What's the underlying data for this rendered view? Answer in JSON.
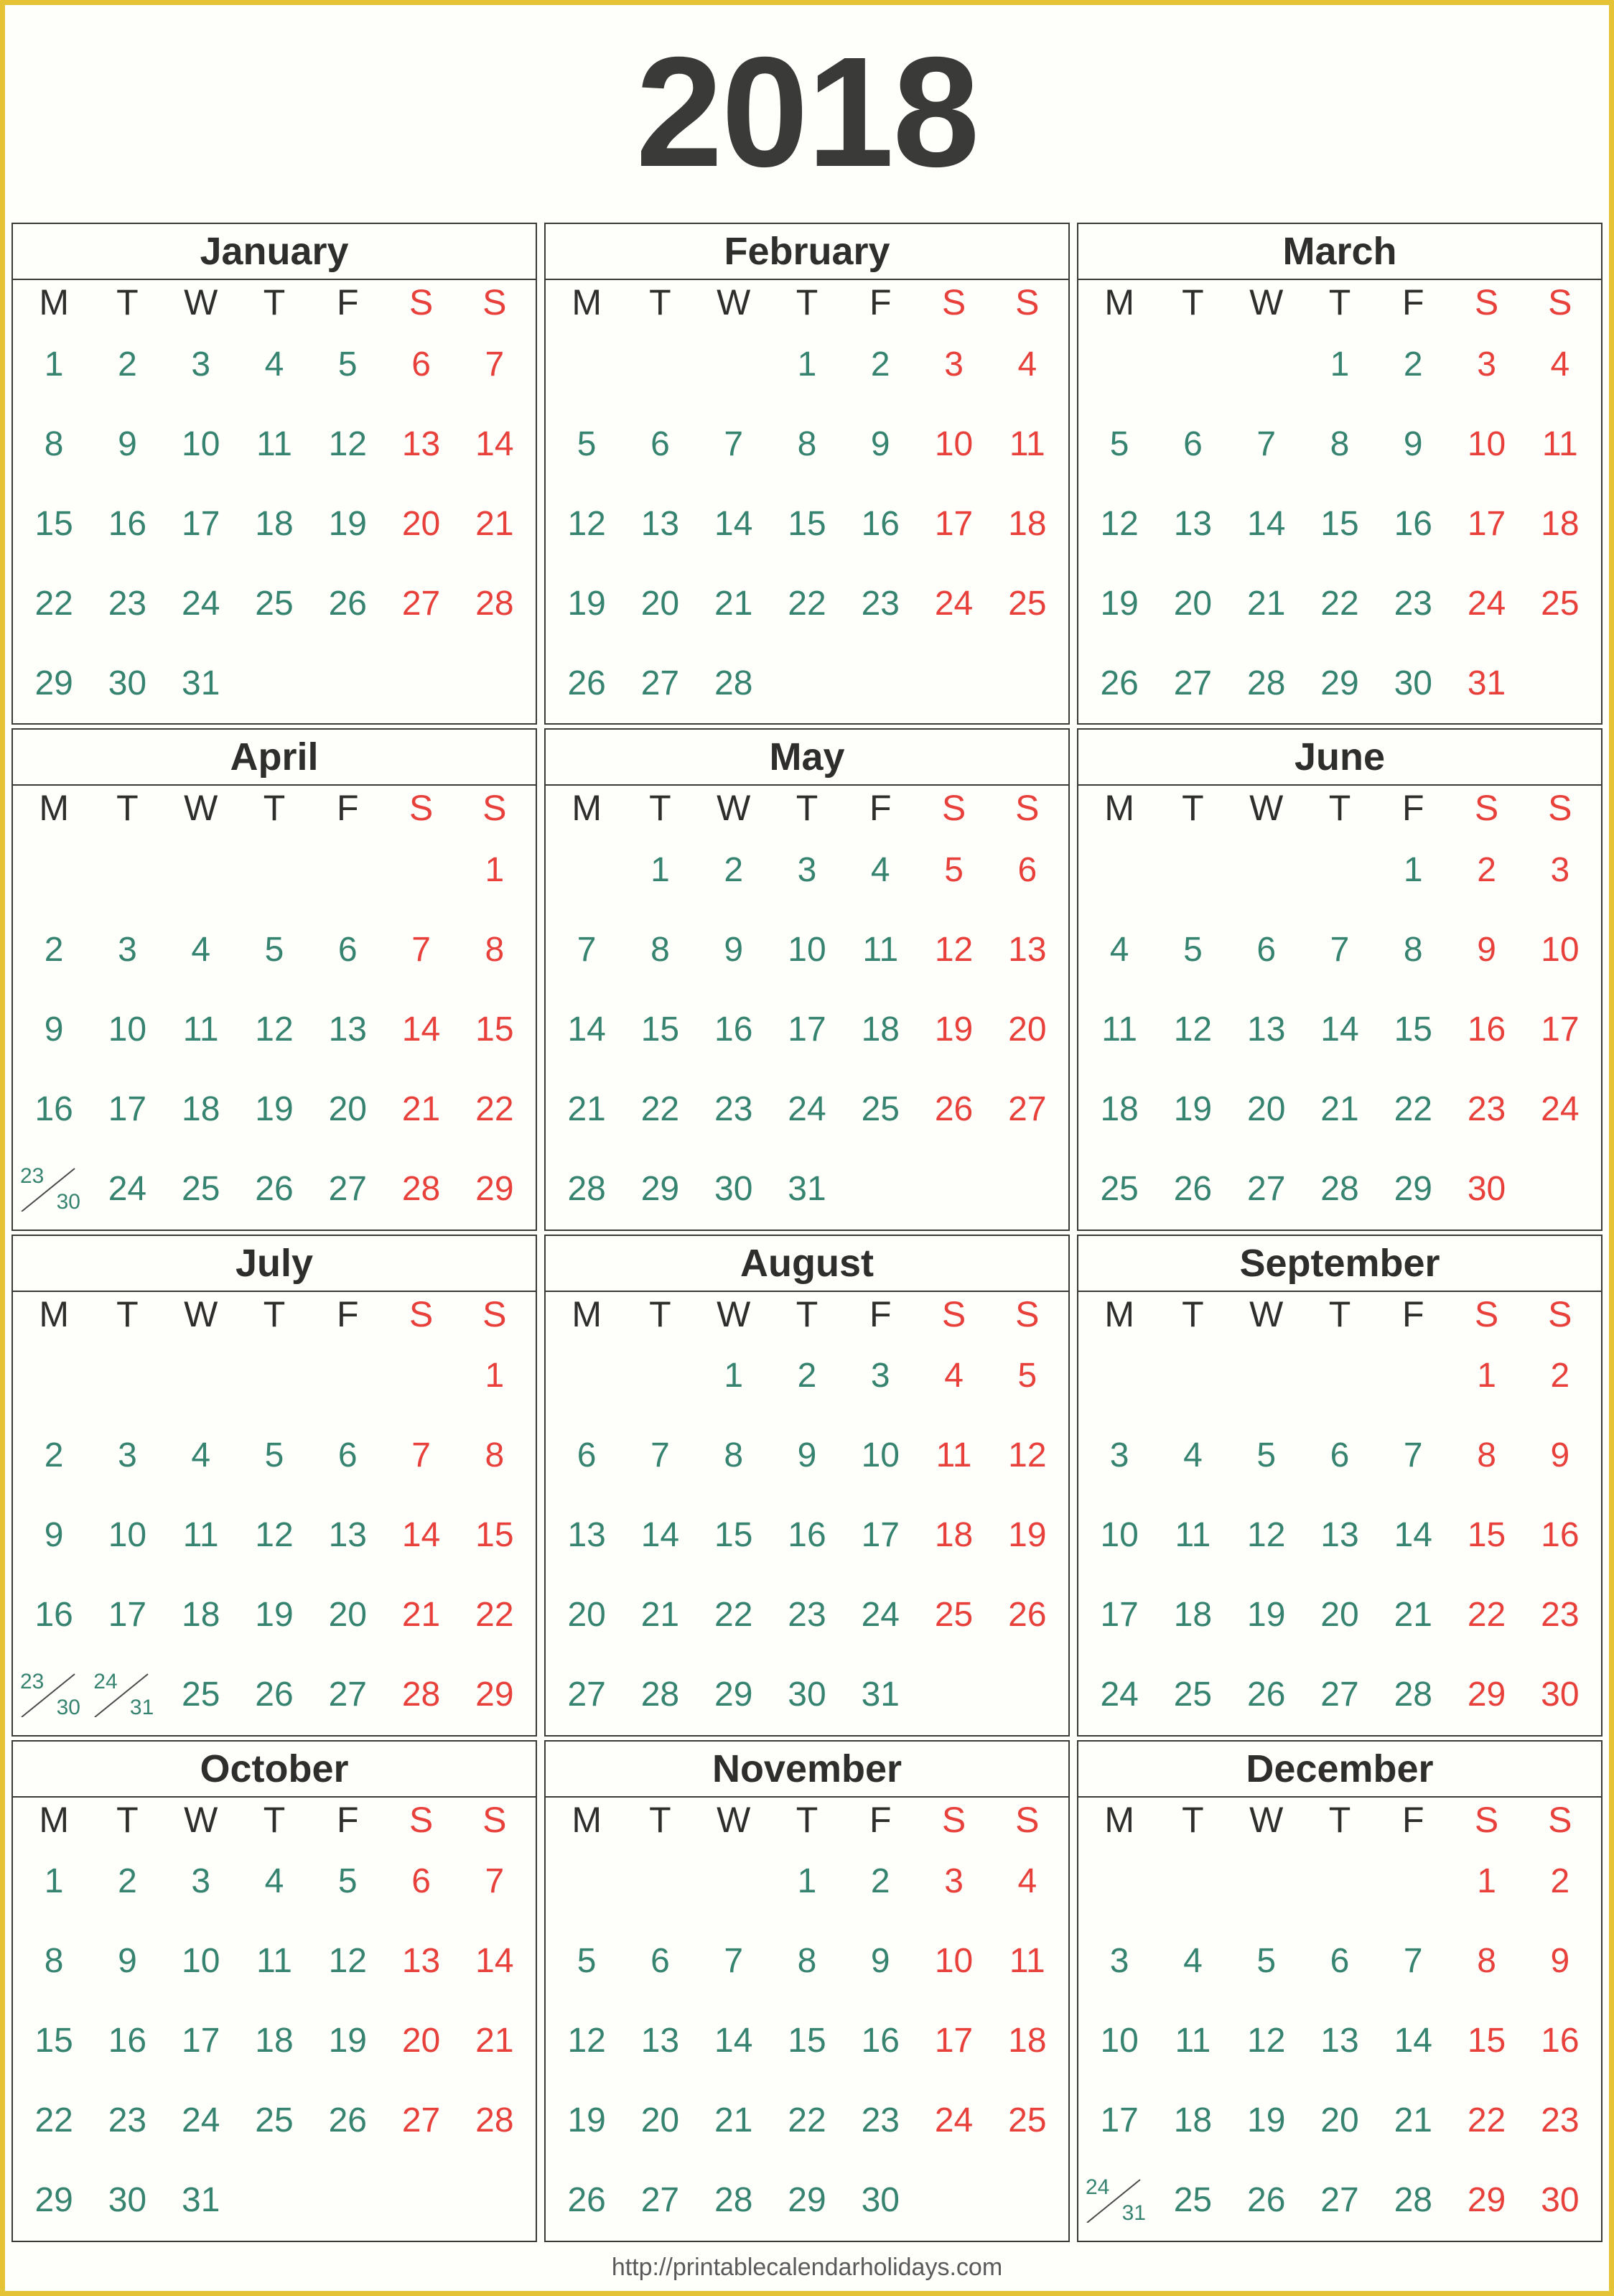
{
  "title": "2018",
  "footer": {
    "url": "http://printablecalendarholidays.com"
  },
  "colors": {
    "border": "#E5C337",
    "weekday": "#368470",
    "weekend": "#E8403A",
    "heading": "#2E2E2D",
    "grid_line": "#3A3A39",
    "page_bg": "#FEFEFB"
  },
  "weekday_headers": [
    {
      "label": "M",
      "weekend": false
    },
    {
      "label": "T",
      "weekend": false
    },
    {
      "label": "W",
      "weekend": false
    },
    {
      "label": "T",
      "weekend": false
    },
    {
      "label": "F",
      "weekend": false
    },
    {
      "label": "S",
      "weekend": true
    },
    {
      "label": "S",
      "weekend": true
    }
  ],
  "months": [
    {
      "name": "January",
      "weeks": [
        [
          "1",
          "2",
          "3",
          "4",
          "5",
          "6",
          "7"
        ],
        [
          "8",
          "9",
          "10",
          "11",
          "12",
          "13",
          "14"
        ],
        [
          "15",
          "16",
          "17",
          "18",
          "19",
          "20",
          "21"
        ],
        [
          "22",
          "23",
          "24",
          "25",
          "26",
          "27",
          "28"
        ],
        [
          "29",
          "30",
          "31",
          "",
          "",
          "",
          ""
        ]
      ]
    },
    {
      "name": "February",
      "weeks": [
        [
          "",
          "",
          "",
          "1",
          "2",
          "3",
          "4"
        ],
        [
          "5",
          "6",
          "7",
          "8",
          "9",
          "10",
          "11"
        ],
        [
          "12",
          "13",
          "14",
          "15",
          "16",
          "17",
          "18"
        ],
        [
          "19",
          "20",
          "21",
          "22",
          "23",
          "24",
          "25"
        ],
        [
          "26",
          "27",
          "28",
          "",
          "",
          "",
          ""
        ]
      ]
    },
    {
      "name": "March",
      "weeks": [
        [
          "",
          "",
          "",
          "1",
          "2",
          "3",
          "4"
        ],
        [
          "5",
          "6",
          "7",
          "8",
          "9",
          "10",
          "11"
        ],
        [
          "12",
          "13",
          "14",
          "15",
          "16",
          "17",
          "18"
        ],
        [
          "19",
          "20",
          "21",
          "22",
          "23",
          "24",
          "25"
        ],
        [
          "26",
          "27",
          "28",
          "29",
          "30",
          "31",
          ""
        ]
      ]
    },
    {
      "name": "April",
      "weeks": [
        [
          "",
          "",
          "",
          "",
          "",
          "",
          "1"
        ],
        [
          "2",
          "3",
          "4",
          "5",
          "6",
          "7",
          "8"
        ],
        [
          "9",
          "10",
          "11",
          "12",
          "13",
          "14",
          "15"
        ],
        [
          "16",
          "17",
          "18",
          "19",
          "20",
          "21",
          "22"
        ],
        [
          "23/30",
          "24",
          "25",
          "26",
          "27",
          "28",
          "29"
        ]
      ]
    },
    {
      "name": "May",
      "weeks": [
        [
          "",
          "1",
          "2",
          "3",
          "4",
          "5",
          "6"
        ],
        [
          "7",
          "8",
          "9",
          "10",
          "11",
          "12",
          "13"
        ],
        [
          "14",
          "15",
          "16",
          "17",
          "18",
          "19",
          "20"
        ],
        [
          "21",
          "22",
          "23",
          "24",
          "25",
          "26",
          "27"
        ],
        [
          "28",
          "29",
          "30",
          "31",
          "",
          "",
          ""
        ]
      ]
    },
    {
      "name": "June",
      "weeks": [
        [
          "",
          "",
          "",
          "",
          "1",
          "2",
          "3"
        ],
        [
          "4",
          "5",
          "6",
          "7",
          "8",
          "9",
          "10"
        ],
        [
          "11",
          "12",
          "13",
          "14",
          "15",
          "16",
          "17"
        ],
        [
          "18",
          "19",
          "20",
          "21",
          "22",
          "23",
          "24"
        ],
        [
          "25",
          "26",
          "27",
          "28",
          "29",
          "30",
          ""
        ]
      ]
    },
    {
      "name": "July",
      "weeks": [
        [
          "",
          "",
          "",
          "",
          "",
          "",
          "1"
        ],
        [
          "2",
          "3",
          "4",
          "5",
          "6",
          "7",
          "8"
        ],
        [
          "9",
          "10",
          "11",
          "12",
          "13",
          "14",
          "15"
        ],
        [
          "16",
          "17",
          "18",
          "19",
          "20",
          "21",
          "22"
        ],
        [
          "23/30",
          "24/31",
          "25",
          "26",
          "27",
          "28",
          "29"
        ]
      ]
    },
    {
      "name": "August",
      "weeks": [
        [
          "",
          "",
          "1",
          "2",
          "3",
          "4",
          "5"
        ],
        [
          "6",
          "7",
          "8",
          "9",
          "10",
          "11",
          "12"
        ],
        [
          "13",
          "14",
          "15",
          "16",
          "17",
          "18",
          "19"
        ],
        [
          "20",
          "21",
          "22",
          "23",
          "24",
          "25",
          "26"
        ],
        [
          "27",
          "28",
          "29",
          "30",
          "31",
          "",
          ""
        ]
      ]
    },
    {
      "name": "September",
      "weeks": [
        [
          "",
          "",
          "",
          "",
          "",
          "1",
          "2"
        ],
        [
          "3",
          "4",
          "5",
          "6",
          "7",
          "8",
          "9"
        ],
        [
          "10",
          "11",
          "12",
          "13",
          "14",
          "15",
          "16"
        ],
        [
          "17",
          "18",
          "19",
          "20",
          "21",
          "22",
          "23"
        ],
        [
          "24",
          "25",
          "26",
          "27",
          "28",
          "29",
          "30"
        ]
      ]
    },
    {
      "name": "October",
      "weeks": [
        [
          "1",
          "2",
          "3",
          "4",
          "5",
          "6",
          "7"
        ],
        [
          "8",
          "9",
          "10",
          "11",
          "12",
          "13",
          "14"
        ],
        [
          "15",
          "16",
          "17",
          "18",
          "19",
          "20",
          "21"
        ],
        [
          "22",
          "23",
          "24",
          "25",
          "26",
          "27",
          "28"
        ],
        [
          "29",
          "30",
          "31",
          "",
          "",
          "",
          ""
        ]
      ]
    },
    {
      "name": "November",
      "weeks": [
        [
          "",
          "",
          "",
          "1",
          "2",
          "3",
          "4"
        ],
        [
          "5",
          "6",
          "7",
          "8",
          "9",
          "10",
          "11"
        ],
        [
          "12",
          "13",
          "14",
          "15",
          "16",
          "17",
          "18"
        ],
        [
          "19",
          "20",
          "21",
          "22",
          "23",
          "24",
          "25"
        ],
        [
          "26",
          "27",
          "28",
          "29",
          "30",
          "",
          ""
        ]
      ]
    },
    {
      "name": "December",
      "weeks": [
        [
          "",
          "",
          "",
          "",
          "",
          "1",
          "2"
        ],
        [
          "3",
          "4",
          "5",
          "6",
          "7",
          "8",
          "9"
        ],
        [
          "10",
          "11",
          "12",
          "13",
          "14",
          "15",
          "16"
        ],
        [
          "17",
          "18",
          "19",
          "20",
          "21",
          "22",
          "23"
        ],
        [
          "24/31",
          "25",
          "26",
          "27",
          "28",
          "29",
          "30"
        ]
      ]
    }
  ]
}
